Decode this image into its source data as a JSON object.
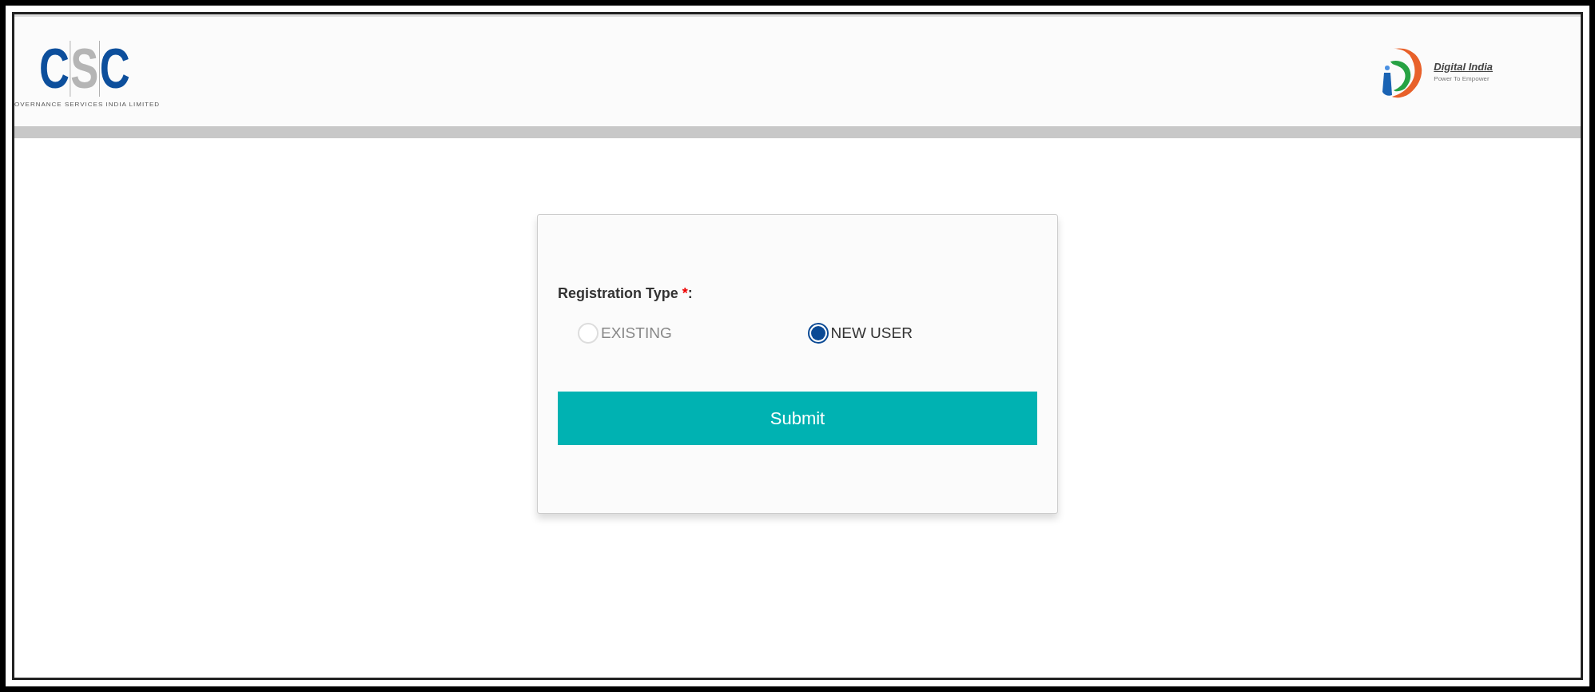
{
  "header": {
    "logo_left": {
      "letters": [
        "C",
        "S",
        "C"
      ],
      "tagline": "OVERNANCE SERVICES INDIA LIMITED"
    },
    "logo_right": {
      "title": "Digital India",
      "tagline": "Power To Empower"
    }
  },
  "form": {
    "label": "Registration Type",
    "required_mark": "*",
    "label_suffix": ":",
    "options": [
      {
        "label": "EXISTING",
        "selected": false,
        "disabled": true
      },
      {
        "label": "NEW USER",
        "selected": true,
        "disabled": false
      }
    ],
    "submit": "Submit"
  }
}
